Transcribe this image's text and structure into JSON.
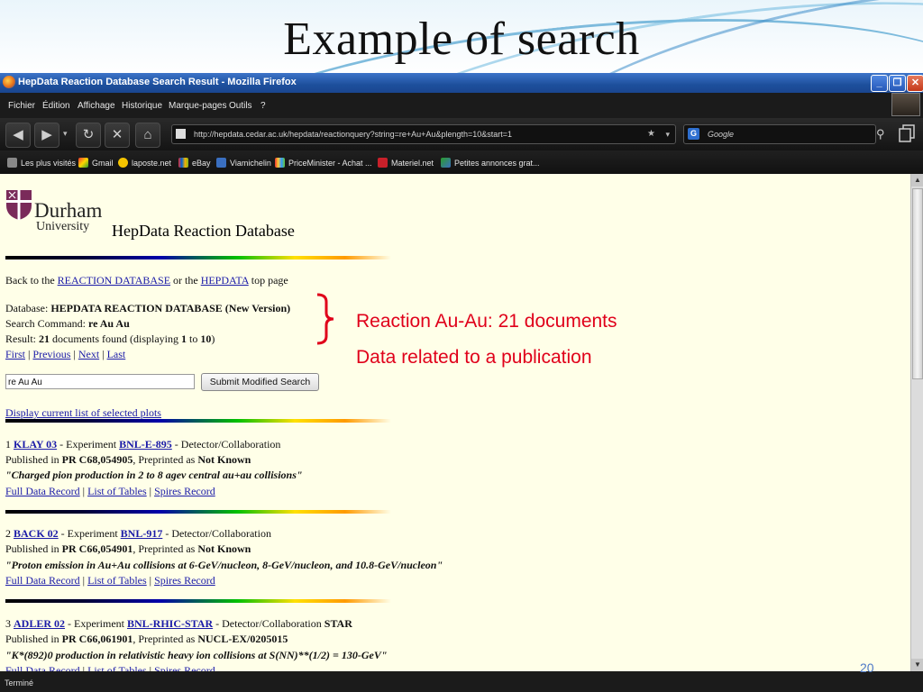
{
  "slide": {
    "title": "Example of search",
    "annotations": [
      "Reaction Au-Au: 21 documents",
      "Data related to a publication"
    ],
    "page_number": "20"
  },
  "browser": {
    "window_title": "HepData Reaction Database Search Result - Mozilla Firefox",
    "menu": [
      "Fichier",
      "Édition",
      "Affichage",
      "Historique",
      "Marque-pages",
      "Outils",
      "?"
    ],
    "url": "http://hepdata.cedar.ac.uk/hepdata/reactionquery?string=re+Au+Au&plength=10&start=1",
    "search_engine": "Google",
    "bookmarks": [
      "Les plus visités",
      "Gmail",
      "laposte.net",
      "eBay",
      "Viamichelin",
      "PriceMinister - Achat ...",
      "Materiel.net",
      "Petites annonces grat..."
    ],
    "status": "Terminé"
  },
  "page": {
    "logo": {
      "name": "Durham",
      "sub": "University"
    },
    "title": "HepData Reaction Database",
    "back": {
      "prefix": "Back to the",
      "link1": "REACTION DATABASE",
      "mid": "or the",
      "link2": "HEPDATA",
      "suffix": "top page"
    },
    "database": {
      "label": "Database:",
      "value": "HEPDATA REACTION DATABASE (New Version)"
    },
    "command": {
      "label": "Search Command:",
      "value": "re Au Au"
    },
    "result": {
      "label": "Result:",
      "count": "21",
      "text": "documents found (displaying",
      "from": "1",
      "to_text": "to",
      "to": "10",
      "close": ")"
    },
    "nav": [
      "First",
      "Previous",
      "Next",
      "Last"
    ],
    "query_value": "re Au Au",
    "submit_label": "Submit Modified Search",
    "plots_link": "Display current list of selected plots",
    "labels": {
      "experiment": "- Experiment",
      "detector": "- Detector/Collaboration",
      "published": "Published in",
      "preprinted": ", Preprinted as"
    },
    "record_links": [
      "Full Data Record",
      "List of Tables",
      "Spires Record"
    ],
    "results": [
      {
        "num": "1",
        "key": "KLAY 03",
        "experiment": "BNL-E-895",
        "collab": "",
        "journal": "PR C68,054905",
        "preprint": "Not Known",
        "title": "\"Charged pion production in 2 to 8 agev central au+au collisions\""
      },
      {
        "num": "2",
        "key": "BACK 02",
        "experiment": "BNL-917",
        "collab": "",
        "journal": "PR C66,054901",
        "preprint": "Not Known",
        "title": "\"Proton emission in Au+Au collisions at 6-GeV/nucleon, 8-GeV/nucleon, and 10.8-GeV/nucleon\""
      },
      {
        "num": "3",
        "key": "ADLER 02",
        "experiment": "BNL-RHIC-STAR",
        "collab": "STAR",
        "journal": "PR C66,061901",
        "preprint": "NUCL-EX/0205015",
        "title": "\"K*(892)0 production in relativistic heavy ion collisions at S(NN)**(1/2) = 130-GeV\""
      }
    ]
  },
  "colors": {
    "annotation": "#e0001a",
    "link": "#1a1aa8",
    "page_bg": "#ffffe8",
    "titlebar": "#1d4f9c"
  }
}
